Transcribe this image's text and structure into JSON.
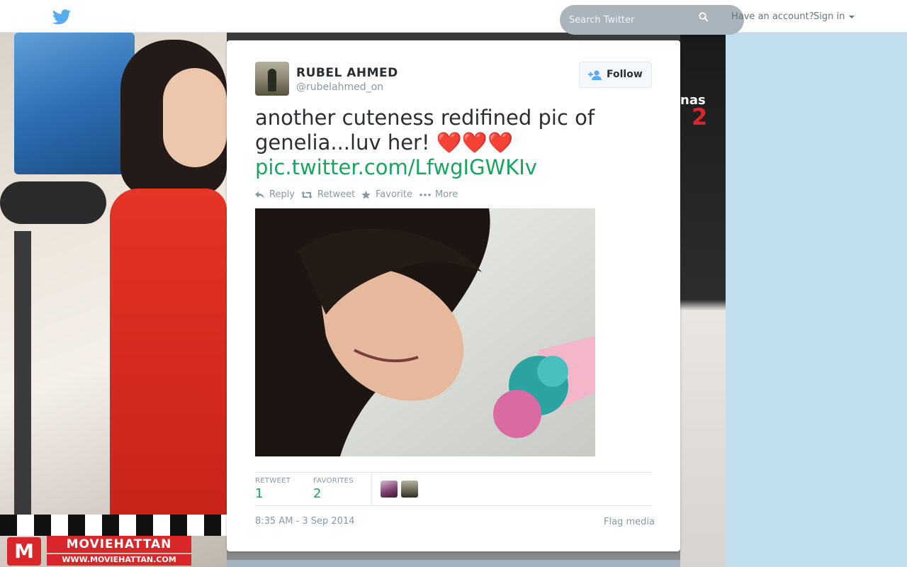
{
  "topbar": {
    "search_placeholder": "Search Twitter",
    "account_prompt": "Have an account?",
    "signin_label": "Sign in"
  },
  "banner": {
    "logo_name": "MOVIEHATTAN",
    "logo_url": "WWW.MOVIEHATTAN.COM",
    "logo_letter": "M",
    "film_text": "nas",
    "film_num": "2"
  },
  "tweet": {
    "fullname": "RUBEL AHMED",
    "screen_name": "@rubelahmed_on",
    "follow_label": "Follow",
    "text": "another cuteness redifined pic of genelia...luv her! ",
    "hearts": "❤️❤️❤️",
    "link": "pic.twitter.com/LfwgIGWKIv",
    "actions": {
      "reply": "Reply",
      "retweet": "Retweet",
      "favorite": "Favorite",
      "more": "More"
    },
    "stats": {
      "retweet_label": "RETWEET",
      "retweet_count": "1",
      "favorites_label": "FAVORITES",
      "favorites_count": "2"
    },
    "timestamp": "8:35 AM - 3 Sep 2014",
    "flag_label": "Flag media"
  },
  "colors": {
    "accent_green": "#19a55e",
    "twitter_blue": "#55acee",
    "page_bg": "#c0deed"
  }
}
